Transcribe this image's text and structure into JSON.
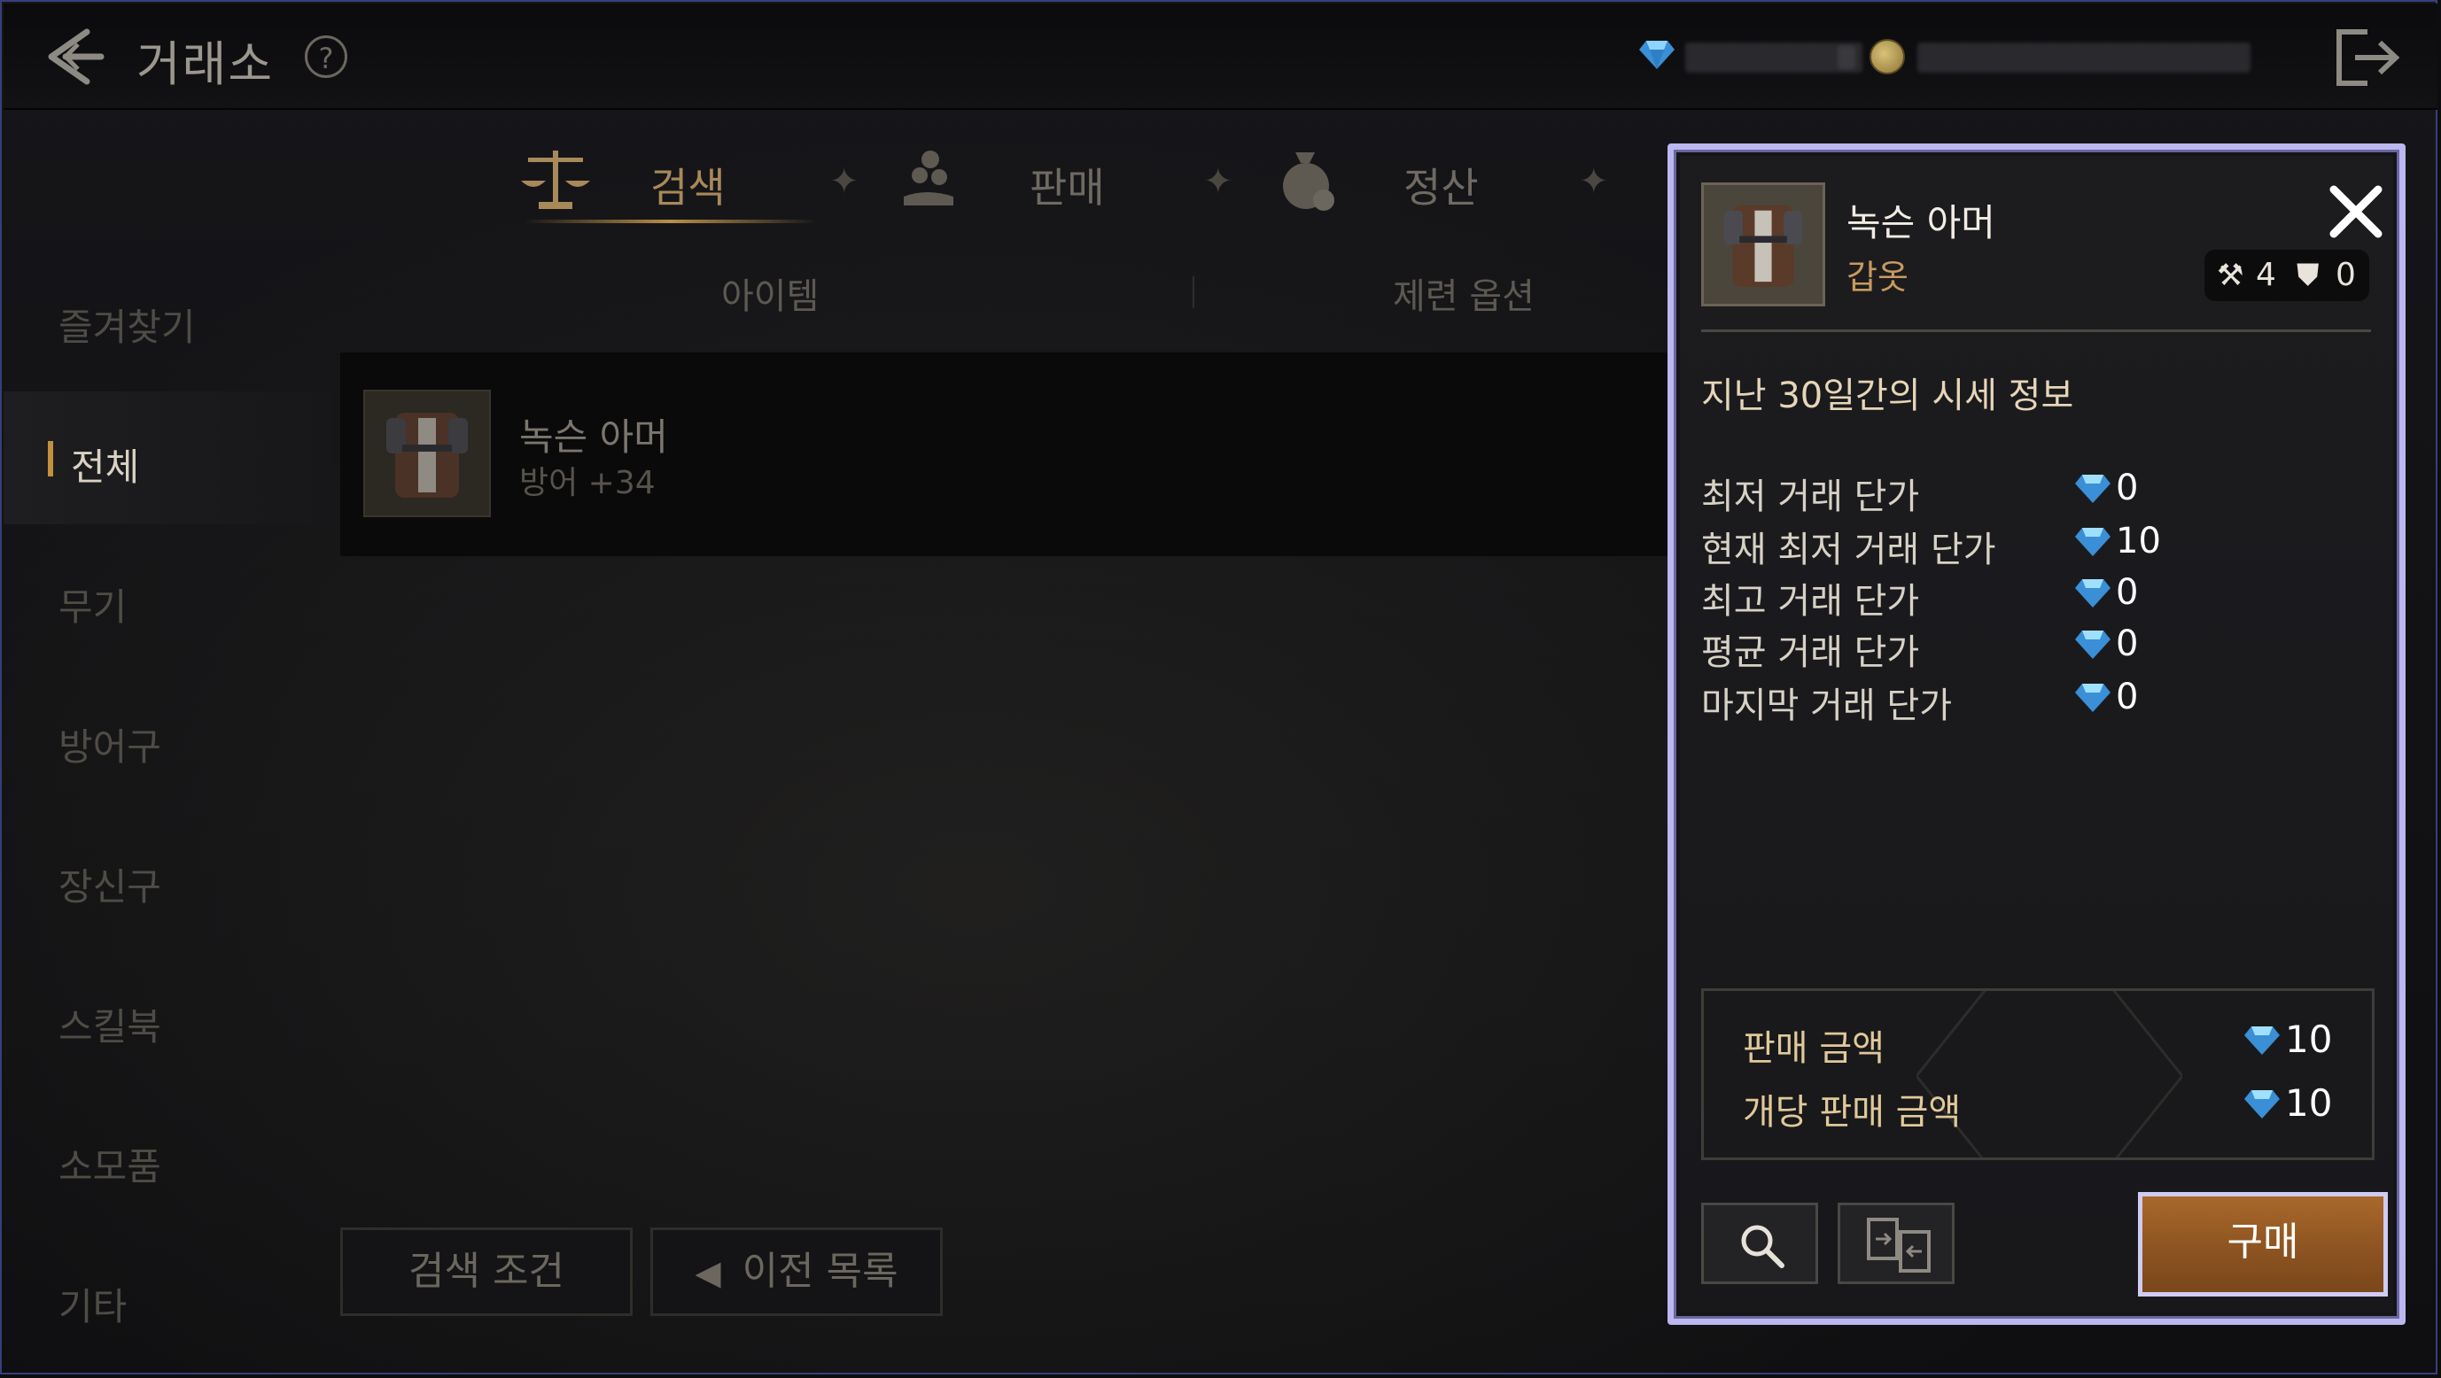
{
  "header": {
    "title": "거래소",
    "help_icon": "question-circle-icon"
  },
  "tabs": [
    {
      "label": "검색",
      "icon": "scale-icon",
      "active": true
    },
    {
      "label": "판매",
      "icon": "hand-coins-icon",
      "active": false
    },
    {
      "label": "정산",
      "icon": "money-bag-icon",
      "active": false
    },
    {
      "label": "",
      "icon": "ledger-icon",
      "active": false
    }
  ],
  "sidebar": {
    "items": [
      {
        "label": "즐겨찾기",
        "active": false
      },
      {
        "label": "전체",
        "active": true
      },
      {
        "label": "무기",
        "active": false
      },
      {
        "label": "방어구",
        "active": false
      },
      {
        "label": "장신구",
        "active": false
      },
      {
        "label": "스킬북",
        "active": false
      },
      {
        "label": "소모품",
        "active": false
      },
      {
        "label": "기타",
        "active": false
      }
    ]
  },
  "list": {
    "columns": [
      "아이템",
      "제련 옵션"
    ],
    "rows": [
      {
        "name": "녹슨 아머",
        "sub": "방어 +34"
      }
    ]
  },
  "bottom_buttons": {
    "search_conditions": "검색 조건",
    "previous_list": "이전 목록"
  },
  "modal": {
    "item_name": "녹슨 아머",
    "item_type": "갑옷",
    "badge": {
      "enhance": "4",
      "durability": "0"
    },
    "section_title": "지난 30일간의 시세 정보",
    "prices": [
      {
        "label": "최저 거래 단가",
        "value": "0"
      },
      {
        "label": "현재 최저 거래 단가",
        "value": "10"
      },
      {
        "label": "최고 거래 단가",
        "value": "0"
      },
      {
        "label": "평균 거래 단가",
        "value": "0"
      },
      {
        "label": "마지막 거래 단가",
        "value": "0"
      }
    ],
    "summary": [
      {
        "label": "판매 금액",
        "value": "10"
      },
      {
        "label": "개당 판매 금액",
        "value": "10"
      }
    ],
    "buy_label": "구매"
  },
  "colors": {
    "accent_gold": "#c4903e",
    "buy_button": "#9a5c24",
    "modal_border": "#bcb7ef",
    "gem_blue": "#4fb7f0"
  }
}
